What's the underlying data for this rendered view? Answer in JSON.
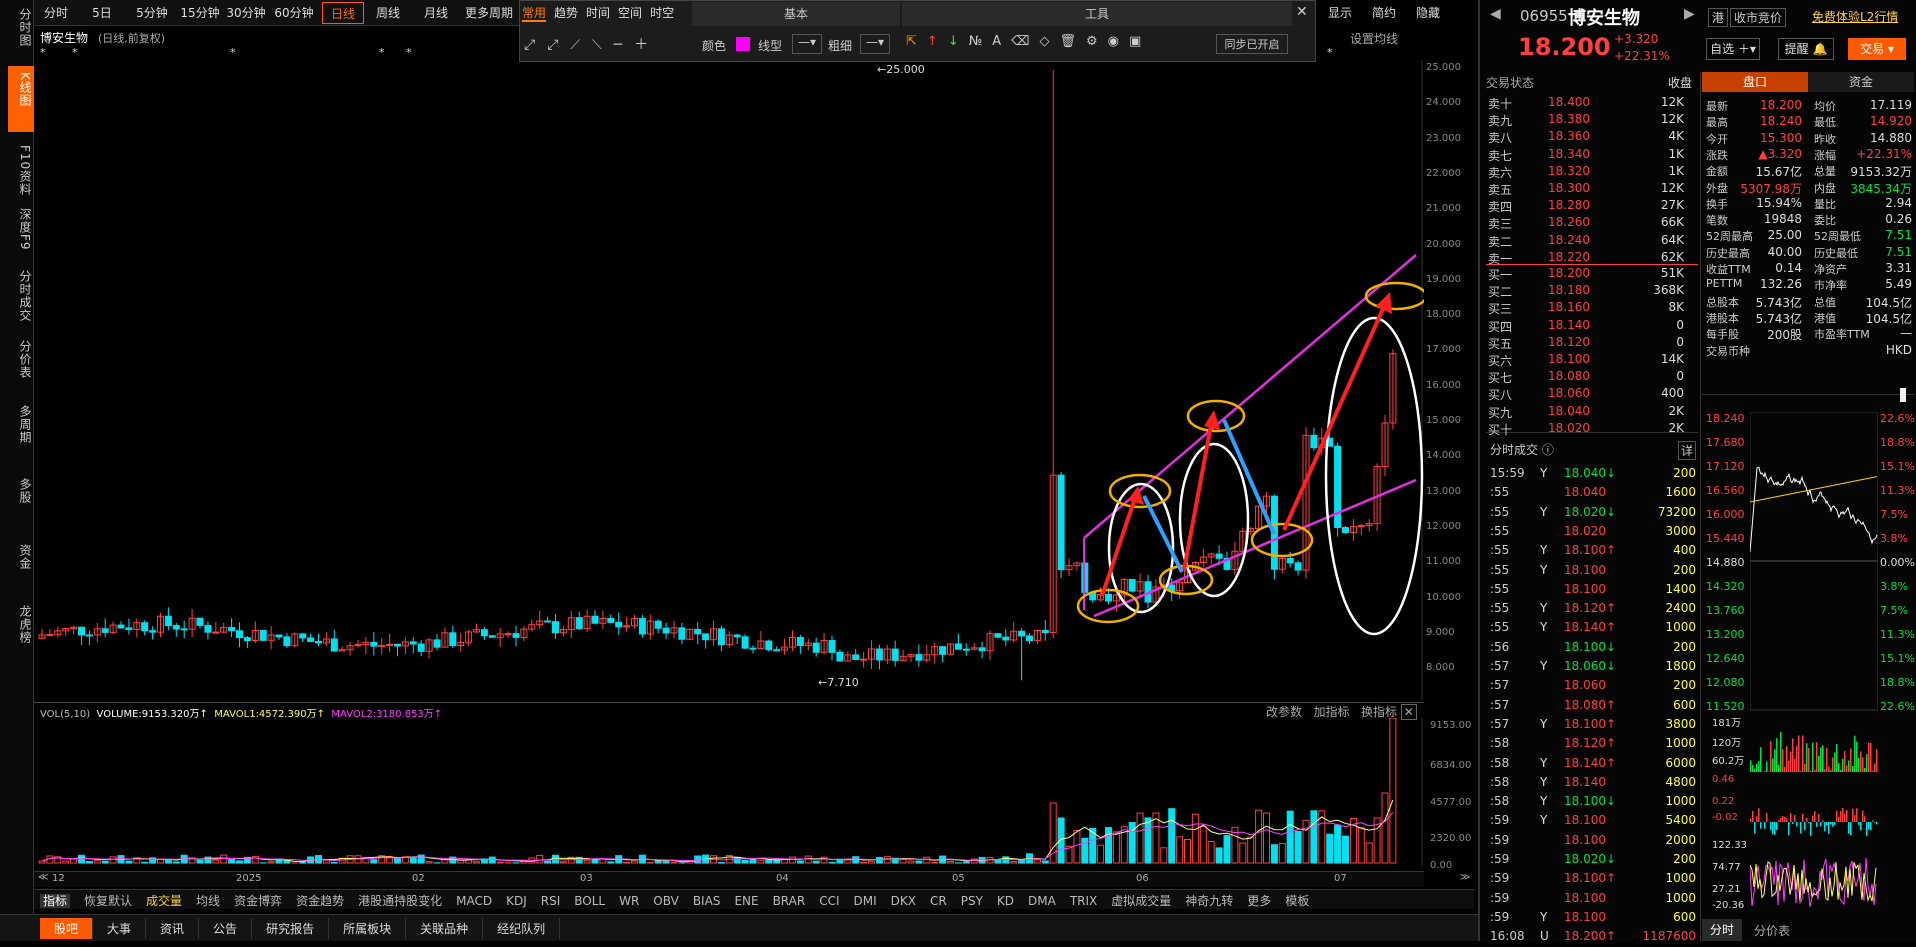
{
  "top_tabs": [
    "分时",
    "5日",
    "5分钟",
    "15分钟",
    "30分钟",
    "60分钟",
    "日线",
    "周线",
    "月线",
    "更多周期"
  ],
  "drawing_tabs": [
    "常用",
    "趋势",
    "时间",
    "空间",
    "时空"
  ],
  "toolbar": {
    "basic": "基本",
    "tools": "工具",
    "color_label": "颜色",
    "line_type": "线型",
    "thickness": "粗细",
    "sync": "同步已开启",
    "display": "显示",
    "simple": "简约",
    "hide": "隐藏",
    "set_ma": "设置均线"
  },
  "left_tabs": [
    "分时图",
    "K线图",
    "F10资料",
    "深度F9",
    "分时成交",
    "分价表",
    "多周期",
    "多股",
    "资金",
    "龙虎榜"
  ],
  "chart_title": "博安生物",
  "chart_subtitle": "(日线,前复权)",
  "price_axis": [
    "25.000",
    "24.000",
    "23.000",
    "22.000",
    "21.000",
    "20.000",
    "19.000",
    "18.000",
    "17.000",
    "16.000",
    "15.000",
    "14.000",
    "13.000",
    "12.000",
    "11.000",
    "10.000",
    "9.000",
    "8.000"
  ],
  "max_label": "25.000",
  "min_label": "7.710",
  "vol_axis": [
    "9153.00",
    "6834.00",
    "4577.00",
    "2320.00",
    "0.00"
  ],
  "vol_legend": {
    "name": "VOL(5,10)",
    "volume": "VOLUME:9153.320万",
    "ma1": "MAVOL1:4572.390万",
    "ma2": "MAVOL2:3180.853万"
  },
  "vol_actions": [
    "改参数",
    "加指标",
    "换指标"
  ],
  "x_axis": [
    "12",
    "2025",
    "02",
    "03",
    "04",
    "05",
    "06",
    "07"
  ],
  "indicators": [
    "指标",
    "恢复默认",
    "成交量",
    "均线",
    "资金博弈",
    "资金趋势",
    "港股通持股变化",
    "MACD",
    "KDJ",
    "RSI",
    "BOLL",
    "WR",
    "OBV",
    "BIAS",
    "ENE",
    "BRAR",
    "CCI",
    "DMI",
    "DKX",
    "CR",
    "PSY",
    "KD",
    "DMA",
    "TRIX",
    "虚拟成交量",
    "神奇九转",
    "更多",
    "模板"
  ],
  "bottom_tabs": [
    "股吧",
    "大事",
    "资讯",
    "公告",
    "研究报告",
    "所属板块",
    "关联品种",
    "经纪队列"
  ],
  "chart_data": {
    "type": "candlestick",
    "title": "博安生物 (日线,前复权)",
    "ylim": [
      7.5,
      25.5
    ],
    "high": 25.0,
    "low": 7.71,
    "last": 18.2
  },
  "stock": {
    "code": "06955",
    "name": "博安生物",
    "price": "18.200",
    "change": "+3.320",
    "pct": "+22.31%",
    "hk_tag": "港",
    "auction": "收市竞价",
    "l2": "免费体验L2行情",
    "optional": "自选",
    "remind": "提醒",
    "trade": "交易"
  },
  "book_header": {
    "title": "交易状态",
    "status": "收盘"
  },
  "sells": [
    [
      "卖十",
      "18.400",
      "12K"
    ],
    [
      "卖九",
      "18.380",
      "12K"
    ],
    [
      "卖八",
      "18.360",
      "4K"
    ],
    [
      "卖七",
      "18.340",
      "1K"
    ],
    [
      "卖六",
      "18.320",
      "1K"
    ],
    [
      "卖五",
      "18.300",
      "12K"
    ],
    [
      "卖四",
      "18.280",
      "27K"
    ],
    [
      "卖三",
      "18.260",
      "66K"
    ],
    [
      "卖二",
      "18.240",
      "64K"
    ],
    [
      "卖一",
      "18.220",
      "62K"
    ]
  ],
  "buys": [
    [
      "买一",
      "18.200",
      "51K"
    ],
    [
      "买二",
      "18.180",
      "368K"
    ],
    [
      "买三",
      "18.160",
      "8K"
    ],
    [
      "买四",
      "18.140",
      "0"
    ],
    [
      "买五",
      "18.120",
      "0"
    ],
    [
      "买六",
      "18.100",
      "14K"
    ],
    [
      "买七",
      "18.080",
      "0"
    ],
    [
      "买八",
      "18.060",
      "400"
    ],
    [
      "买九",
      "18.040",
      "2K"
    ],
    [
      "买十",
      "18.020",
      "2K"
    ]
  ],
  "panel_tabs": [
    "盘口",
    "资金"
  ],
  "quote": [
    [
      "最新",
      "18.200",
      "均价",
      "17.119"
    ],
    [
      "最高",
      "18.240",
      "最低",
      "14.920"
    ],
    [
      "今开",
      "15.300",
      "昨收",
      "14.880"
    ],
    [
      "涨跌",
      "▲3.320",
      "涨幅",
      "+22.31%"
    ],
    [
      "金额",
      "15.67亿",
      "总量",
      "9153.32万"
    ],
    [
      "外盘",
      "5307.98万",
      "内盘",
      "3845.34万"
    ],
    [
      "换手",
      "15.94%",
      "量比",
      "2.94"
    ],
    [
      "笔数",
      "19848",
      "委比",
      "0.26"
    ],
    [
      "52周最高",
      "25.00",
      "52周最低",
      "7.51"
    ],
    [
      "历史最高",
      "40.00",
      "历史最低",
      "7.51"
    ],
    [
      "收益TTM",
      "0.14",
      "净资产",
      "3.31"
    ],
    [
      "PETTM",
      "132.26",
      "市净率",
      "5.49"
    ],
    [
      "总股本",
      "5.743亿",
      "总值",
      "104.5亿"
    ],
    [
      "港股本",
      "5.743亿",
      "港值",
      "104.5亿"
    ],
    [
      "每手股",
      "200股",
      "市盈率TTM",
      "—"
    ],
    [
      "交易币种",
      "",
      "",
      "HKD"
    ]
  ],
  "ticks_header": {
    "title": "分时成交",
    "detail": "详"
  },
  "ticks": [
    [
      "15:59",
      "Y",
      "18.040",
      "↓",
      "200"
    ],
    [
      ":55",
      "",
      "18.040",
      "",
      "1600"
    ],
    [
      ":55",
      "Y",
      "18.020",
      "↓",
      "73200"
    ],
    [
      ":55",
      "",
      "18.020",
      "",
      "3000"
    ],
    [
      ":55",
      "Y",
      "18.100",
      "↑",
      "400"
    ],
    [
      ":55",
      "Y",
      "18.100",
      "",
      "200"
    ],
    [
      ":55",
      "",
      "18.100",
      "",
      "1400"
    ],
    [
      ":55",
      "Y",
      "18.120",
      "↑",
      "2400"
    ],
    [
      ":55",
      "Y",
      "18.140",
      "↑",
      "1000"
    ],
    [
      ":56",
      "",
      "18.100",
      "↓",
      "200"
    ],
    [
      ":57",
      "Y",
      "18.060",
      "↓",
      "1800"
    ],
    [
      ":57",
      "",
      "18.060",
      "",
      "200"
    ],
    [
      ":57",
      "",
      "18.080",
      "↑",
      "600"
    ],
    [
      ":57",
      "Y",
      "18.100",
      "↑",
      "3800"
    ],
    [
      ":58",
      "",
      "18.120",
      "↑",
      "1000"
    ],
    [
      ":58",
      "Y",
      "18.140",
      "↑",
      "6000"
    ],
    [
      ":58",
      "Y",
      "18.140",
      "",
      "4800"
    ],
    [
      ":58",
      "Y",
      "18.100",
      "↓",
      "1000"
    ],
    [
      ":59",
      "Y",
      "18.100",
      "",
      "5400"
    ],
    [
      ":59",
      "",
      "18.100",
      "",
      "2000"
    ],
    [
      ":59",
      "",
      "18.020",
      "↓",
      "200"
    ],
    [
      ":59",
      "",
      "18.100",
      "↑",
      "1000"
    ],
    [
      ":59",
      "",
      "18.100",
      "",
      "1000"
    ],
    [
      ":59",
      "Y",
      "18.100",
      "",
      "600"
    ],
    [
      "16:08",
      "U",
      "18.200",
      "↑",
      "1187600"
    ]
  ],
  "mini_axis_left": [
    "18.240",
    "17.680",
    "17.120",
    "16.560",
    "16.000",
    "15.440",
    "14.880",
    "14.320",
    "13.760",
    "13.200",
    "12.640",
    "12.080",
    "11.520"
  ],
  "mini_axis_right": [
    "22.6%",
    "18.8%",
    "15.1%",
    "11.3%",
    "7.5%",
    "3.8%",
    "0.00%",
    "3.8%",
    "7.5%",
    "11.3%",
    "15.1%",
    "18.8%",
    "22.6%"
  ],
  "mini_sub_axis": [
    "181万",
    "120万",
    "60.2万",
    "0.46",
    "0.22",
    "-0.02",
    "122.33",
    "74.77",
    "27.21",
    "-20.36"
  ],
  "mini_tabs": [
    "分时",
    "分价表"
  ]
}
